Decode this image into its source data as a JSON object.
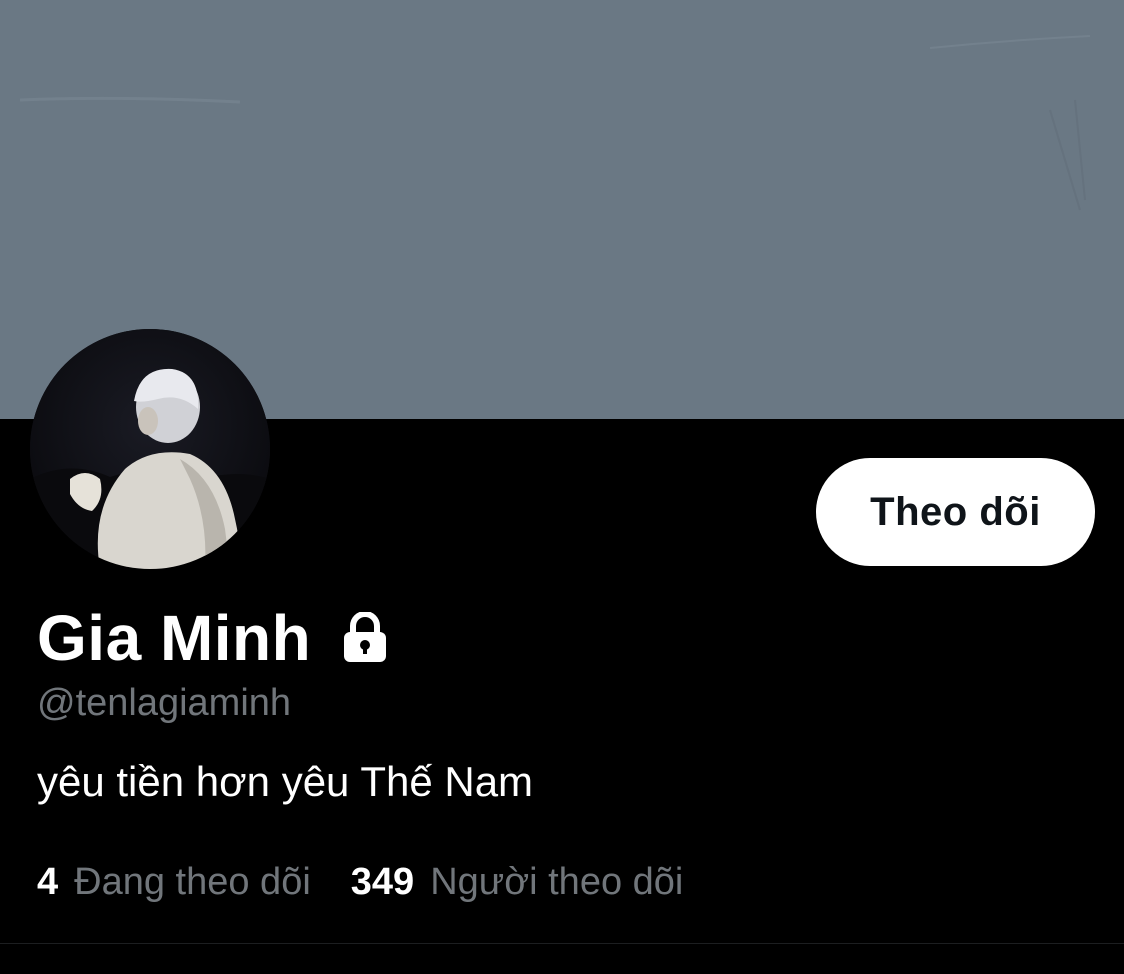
{
  "profile": {
    "display_name": "Gia Minh",
    "handle": "@tenlagiaminh",
    "bio": "yêu tiền hơn yêu Thế Nam",
    "protected_icon": "lock-icon"
  },
  "actions": {
    "follow_label": "Theo dõi"
  },
  "stats": {
    "following_count": "4",
    "following_label": "Đang theo dõi",
    "followers_count": "349",
    "followers_label": "Người theo dõi"
  },
  "colors": {
    "banner": "#6a7884",
    "background": "#000000",
    "secondary_text": "#71767b",
    "button_bg": "#ffffff",
    "button_text": "#0f1419"
  }
}
